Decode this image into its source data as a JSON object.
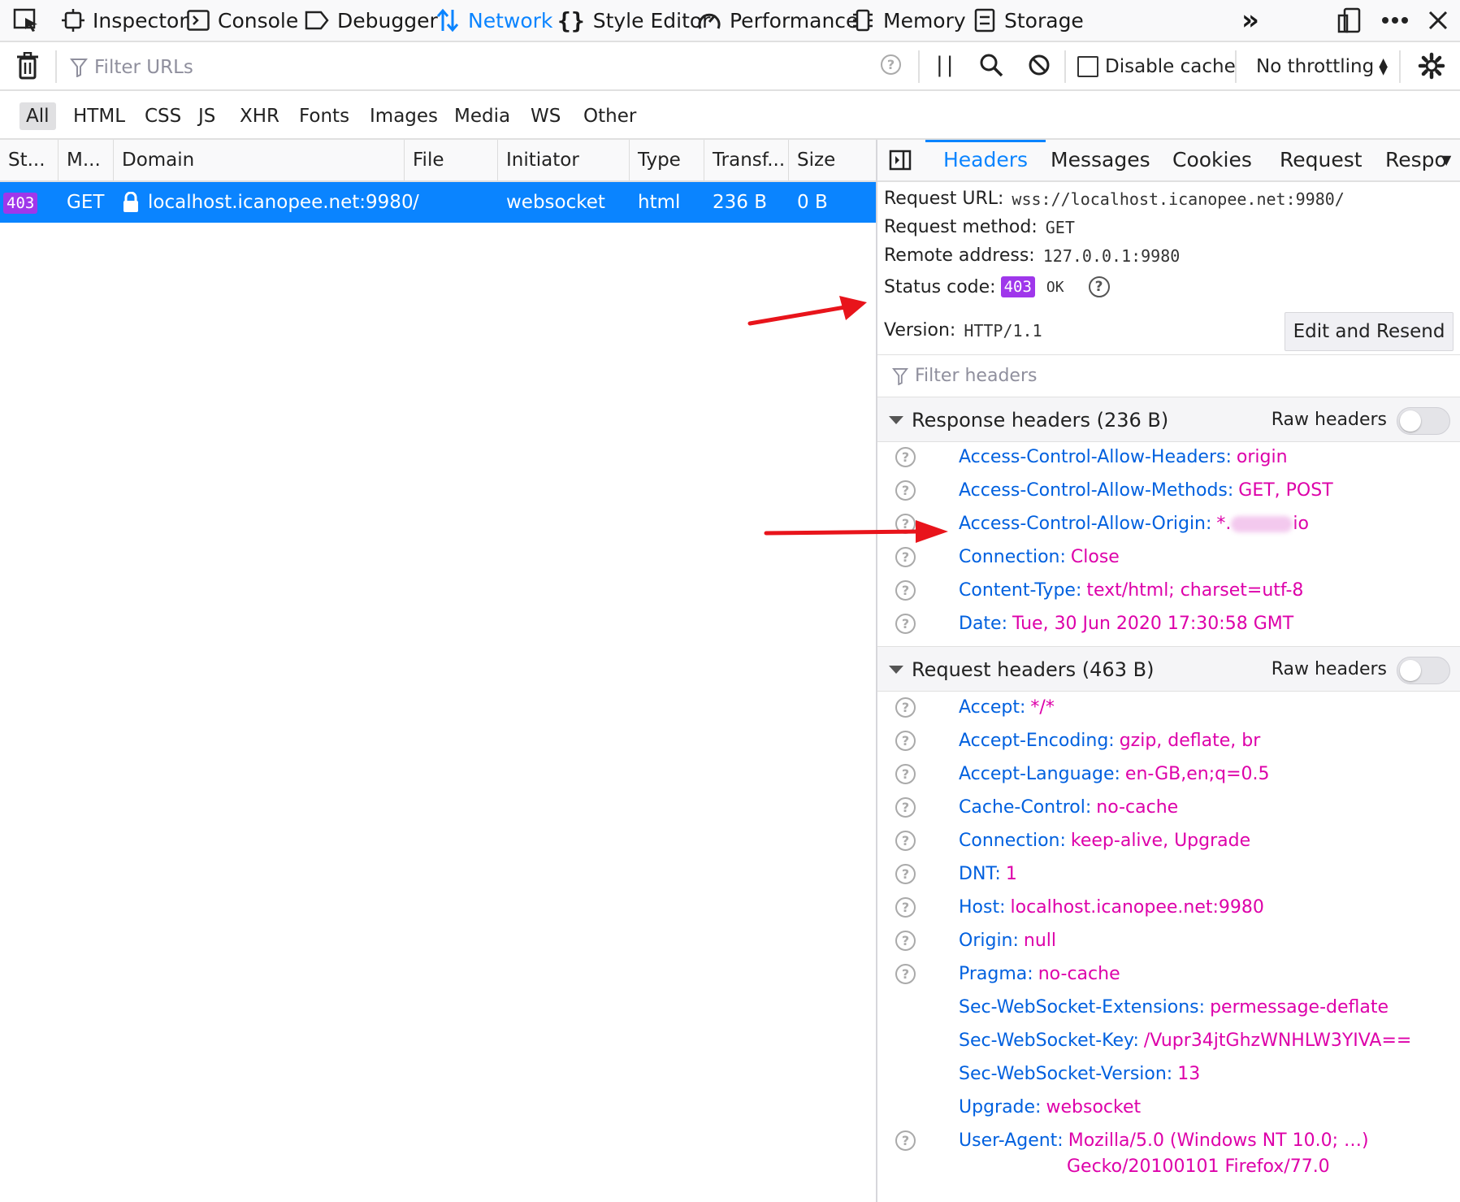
{
  "toolbar": {
    "tools": [
      {
        "label": "Inspector",
        "icon": "inspector-icon"
      },
      {
        "label": "Console",
        "icon": "console-icon"
      },
      {
        "label": "Debugger",
        "icon": "debugger-icon"
      },
      {
        "label": "Network",
        "icon": "network-icon",
        "active": true
      },
      {
        "label": "Style Editor",
        "icon": "style-editor-icon"
      },
      {
        "label": "Performance",
        "icon": "performance-icon"
      },
      {
        "label": "Memory",
        "icon": "memory-icon"
      },
      {
        "label": "Storage",
        "icon": "storage-icon"
      }
    ],
    "overflow_label": "»"
  },
  "filterbar": {
    "filter_placeholder": "Filter URLs",
    "disable_cache_label": "Disable cache",
    "throttling_label": "No throttling"
  },
  "type_filters": [
    "All",
    "HTML",
    "CSS",
    "JS",
    "XHR",
    "Fonts",
    "Images",
    "Media",
    "WS",
    "Other"
  ],
  "table": {
    "columns": [
      "St...",
      "M...",
      "Domain",
      "File",
      "Initiator",
      "Type",
      "Transf...",
      "Size"
    ],
    "rows": [
      {
        "status": "403",
        "method": "GET",
        "domain": "localhost.icanopee.net:9980",
        "file": "/",
        "initiator": "websocket",
        "type": "html",
        "transferred": "236 B",
        "size": "0 B"
      }
    ]
  },
  "details": {
    "tabs": [
      "Headers",
      "Messages",
      "Cookies",
      "Request",
      "Respo"
    ],
    "request_url_label": "Request URL:",
    "request_url": "wss://localhost.icanopee.net:9980/",
    "request_method_label": "Request method:",
    "request_method": "GET",
    "remote_address_label": "Remote address:",
    "remote_address": "127.0.0.1:9980",
    "status_code_label": "Status code:",
    "status_code": "403",
    "status_text": "OK",
    "version_label": "Version:",
    "version": "HTTP/1.1",
    "edit_resend_label": "Edit and Resend",
    "filter_headers_placeholder": "Filter headers",
    "raw_headers_label": "Raw headers",
    "response_section_title": "Response headers (236 B)",
    "response_headers": [
      {
        "name": "Access-Control-Allow-Headers:",
        "value": "origin"
      },
      {
        "name": "Access-Control-Allow-Methods:",
        "value": "GET, POST"
      },
      {
        "name": "Access-Control-Allow-Origin:",
        "value": "*.",
        "value_suffix": "io"
      },
      {
        "name": "Connection:",
        "value": "Close"
      },
      {
        "name": "Content-Type:",
        "value": "text/html; charset=utf-8"
      },
      {
        "name": "Date:",
        "value": "Tue, 30 Jun 2020 17:30:58 GMT"
      }
    ],
    "request_section_title": "Request headers (463 B)",
    "request_headers": [
      {
        "name": "Accept:",
        "value": "*/*"
      },
      {
        "name": "Accept-Encoding:",
        "value": "gzip, deflate, br"
      },
      {
        "name": "Accept-Language:",
        "value": "en-GB,en;q=0.5"
      },
      {
        "name": "Cache-Control:",
        "value": "no-cache"
      },
      {
        "name": "Connection:",
        "value": "keep-alive, Upgrade"
      },
      {
        "name": "DNT:",
        "value": "1"
      },
      {
        "name": "Host:",
        "value": "localhost.icanopee.net:9980"
      },
      {
        "name": "Origin:",
        "value": "null"
      },
      {
        "name": "Pragma:",
        "value": "no-cache"
      },
      {
        "name": "Sec-WebSocket-Extensions:",
        "value": "permessage-deflate"
      },
      {
        "name": "Sec-WebSocket-Key:",
        "value": "/Vupr34jtGhzWNHLW3YIVA=="
      },
      {
        "name": "Sec-WebSocket-Version:",
        "value": "13"
      },
      {
        "name": "Upgrade:",
        "value": "websocket"
      },
      {
        "name": "User-Agent:",
        "value": "Mozilla/5.0 (Windows NT 10.0; …)",
        "value_cont": "Gecko/20100101 Firefox/77.0"
      }
    ]
  },
  "colors": {
    "accent": "#0a84ff",
    "status_badge": "#9f37eb",
    "header_name": "#0060df",
    "header_value": "#dd00a9",
    "annotation_arrow": "#e8141b"
  }
}
